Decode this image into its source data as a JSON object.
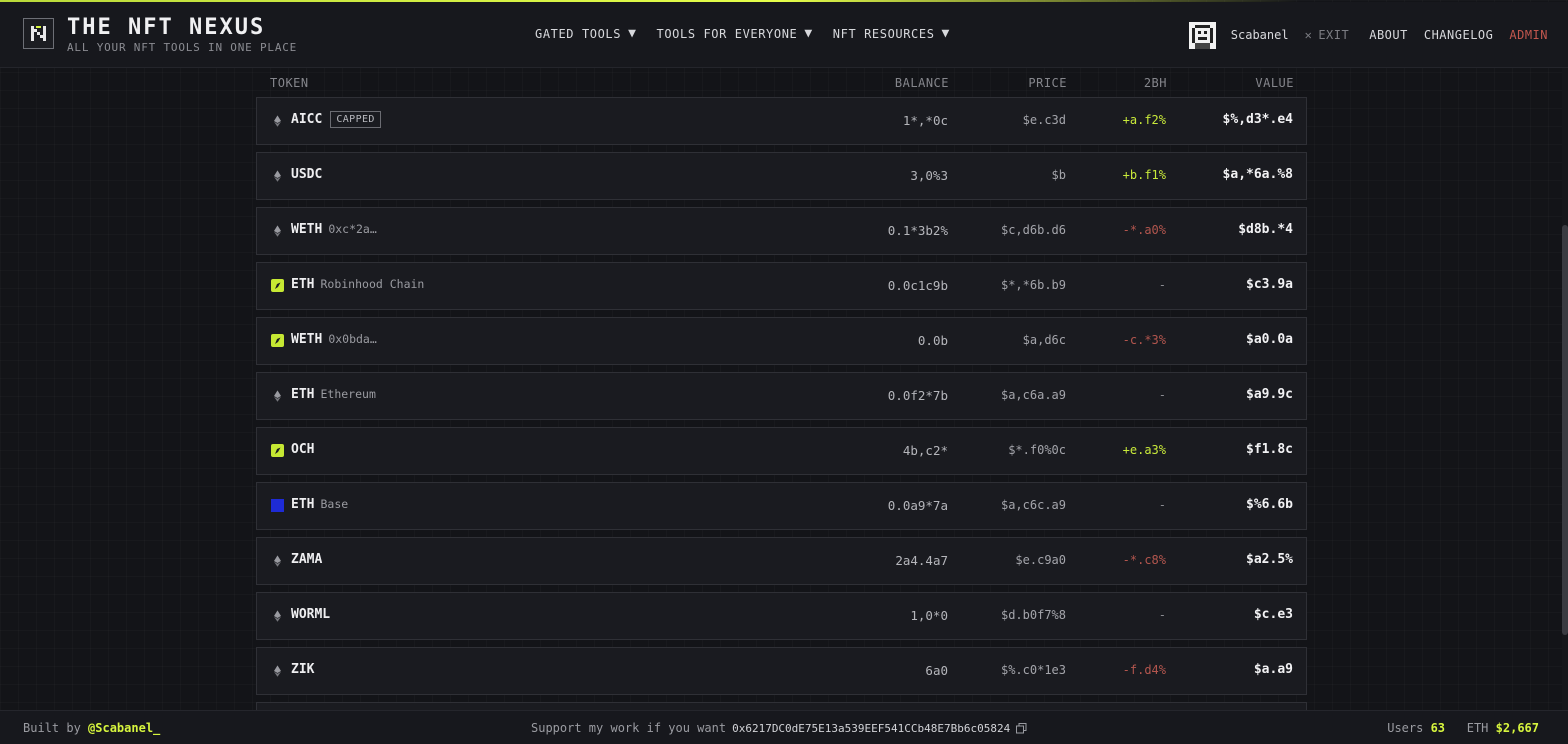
{
  "header": {
    "brand_title": "THE NFT NEXUS",
    "brand_subtitle": "ALL YOUR NFT TOOLS IN ONE PLACE",
    "nav": [
      {
        "label": "GATED TOOLS"
      },
      {
        "label": "TOOLS FOR EVERYONE"
      },
      {
        "label": "NFT RESOURCES"
      }
    ],
    "user_name": "Scabanel",
    "exit_label": "EXIT",
    "links": {
      "about": "ABOUT",
      "changelog": "CHANGELOG",
      "admin": "ADMIN"
    },
    "colors": {
      "accent": "#d7f53e",
      "admin": "#c2574e"
    }
  },
  "table": {
    "columns": {
      "token": "TOKEN",
      "balance": "BALANCE",
      "price": "PRICE",
      "change": "2BH",
      "value": "VALUE"
    },
    "rows": [
      {
        "icon": "eth-diamond-icon",
        "symbol": "AICC",
        "sub": "",
        "badge": "CAPPED",
        "balance": "1*,*0c",
        "price": "$e.c3d",
        "change": "+a.f2%",
        "trend": "pos",
        "value": "$%,d3*.e4"
      },
      {
        "icon": "eth-diamond-icon",
        "symbol": "USDC",
        "sub": "",
        "badge": "",
        "balance": "3,0%3",
        "price": "$b",
        "change": "+b.f1%",
        "trend": "pos",
        "value": "$a,*6a.%8"
      },
      {
        "icon": "eth-diamond-icon",
        "symbol": "WETH",
        "sub": "0xc*2a…",
        "badge": "",
        "balance": "0.1*3b2%",
        "price": "$c,d6b.d6",
        "change": "-*.a0%",
        "trend": "neg",
        "value": "$d8b.*4"
      },
      {
        "icon": "robinhood-chain-icon",
        "symbol": "ETH",
        "sub": "Robinhood Chain",
        "badge": "",
        "balance": "0.0c1c9b",
        "price": "$*,*6b.b9",
        "change": "-",
        "trend": "flat",
        "value": "$c3.9a"
      },
      {
        "icon": "robinhood-chain-icon",
        "symbol": "WETH",
        "sub": "0x0bda…",
        "badge": "",
        "balance": "0.0b",
        "price": "$a,d6c",
        "change": "-c.*3%",
        "trend": "neg",
        "value": "$a0.0a"
      },
      {
        "icon": "eth-diamond-icon",
        "symbol": "ETH",
        "sub": "Ethereum",
        "badge": "",
        "balance": "0.0f2*7b",
        "price": "$a,c6a.a9",
        "change": "-",
        "trend": "flat",
        "value": "$a9.9c"
      },
      {
        "icon": "robinhood-chain-icon",
        "symbol": "OCH",
        "sub": "",
        "badge": "",
        "balance": "4b,c2*",
        "price": "$*.f0%0c",
        "change": "+e.a3%",
        "trend": "pos",
        "value": "$f1.8c"
      },
      {
        "icon": "base-chain-icon",
        "symbol": "ETH",
        "sub": "Base",
        "badge": "",
        "balance": "0.0a9*7a",
        "price": "$a,c6c.a9",
        "change": "-",
        "trend": "flat",
        "value": "$%6.6b"
      },
      {
        "icon": "eth-diamond-icon",
        "symbol": "ZAMA",
        "sub": "",
        "badge": "",
        "balance": "2a4.4a7",
        "price": "$e.c9a0",
        "change": "-*.c8%",
        "trend": "neg",
        "value": "$a2.5%"
      },
      {
        "icon": "eth-diamond-icon",
        "symbol": "WORML",
        "sub": "",
        "badge": "",
        "balance": "1,0*0",
        "price": "$d.b0f7%8",
        "change": "-",
        "trend": "flat",
        "value": "$c.e3"
      },
      {
        "icon": "eth-diamond-icon",
        "symbol": "ZIK",
        "sub": "",
        "badge": "",
        "balance": "6a0",
        "price": "$%.c0*1e3",
        "change": "-f.d4%",
        "trend": "neg",
        "value": "$a.a9"
      }
    ]
  },
  "footer": {
    "built_prefix": "Built by",
    "built_handle": "@Scabanel_",
    "support_text": "Support my work if you want",
    "address": "0x6217DC0dE75E13a539EEF541CCb48E7Bb6c05824",
    "users_label": "Users",
    "users_count": "63",
    "eth_label": "ETH",
    "eth_price": "$2,667"
  }
}
